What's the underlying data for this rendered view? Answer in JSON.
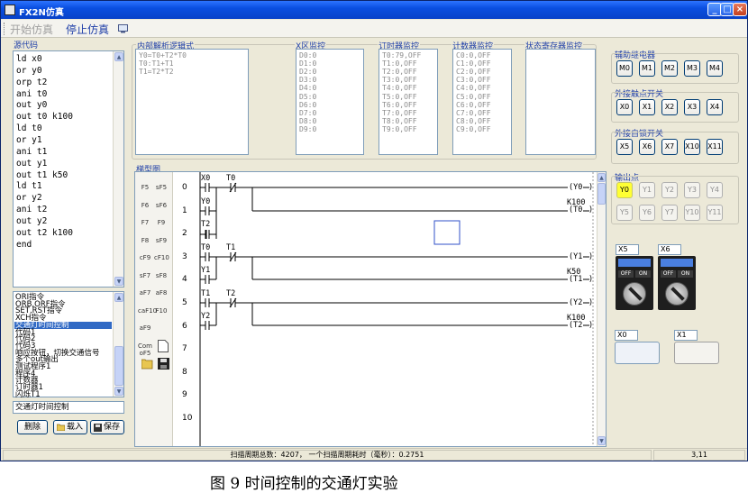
{
  "window": {
    "title": "FX2N仿真",
    "minimize": "_",
    "maximize": "□",
    "close": "×"
  },
  "toolbar": {
    "start_sim": "开始仿真",
    "stop_sim": "停止仿真"
  },
  "source": {
    "label": "源代码",
    "lines": [
      "ld x0",
      "or y0",
      "orp t2",
      "ani t0",
      "out y0",
      "out t0 k100",
      "ld t0",
      "or y1",
      "ani t1",
      "out y1",
      "out t1 k50",
      "ld t1",
      "or y2",
      "ani t2",
      "out y2",
      "out t2 k100",
      "end"
    ]
  },
  "program_list": {
    "items": [
      "ORI指令",
      "ORB,ORF指令",
      "SET,RST指令",
      "XCH指令",
      "交通灯时间控制",
      "代码1",
      "代码2",
      "代码3",
      "响应按钮，切换交通信号",
      "多个out输出",
      "测试程序1",
      "程序4",
      "计数器",
      "订时器1",
      "闪烁T1"
    ],
    "selected_index": 4,
    "selected_name": "交通灯时间控制"
  },
  "buttons": {
    "delete": "删除",
    "load": "载入",
    "save": "保存"
  },
  "logic": {
    "label": "内部解析逻辑式",
    "lines": [
      "Y0=T0+T2*T0",
      "T0:T1+T1",
      "T1=T2*T2"
    ]
  },
  "x_monitor": {
    "label": "X区监控",
    "lines": [
      "D0:0",
      "D1:0",
      "D2:0",
      "D3:0",
      "D4:0",
      "D5:0",
      "D6:0",
      "D7:0",
      "D8:0",
      "D9:0"
    ]
  },
  "timer_monitor": {
    "label": "订时器监控",
    "lines": [
      "T0:79,OFF",
      "T1:0,OFF",
      "T2:0,OFF",
      "T3:0,OFF",
      "T4:0,OFF",
      "T5:0,OFF",
      "T6:0,OFF",
      "T7:0,OFF",
      "T8:0,OFF",
      "T9:0,OFF"
    ]
  },
  "counter_monitor": {
    "label": "计数器监控",
    "lines": [
      "C0:0,OFF",
      "C1:0,OFF",
      "C2:0,OFF",
      "C3:0,OFF",
      "C4:0,OFF",
      "C5:0,OFF",
      "C6:0,OFF",
      "C7:0,OFF",
      "C8:0,OFF",
      "C9:0,OFF"
    ]
  },
  "status_monitor": {
    "label": "状态寄存器监控"
  },
  "ladder": {
    "label": "梯型图",
    "rung_numbers": [
      "0",
      "1",
      "2",
      "3",
      "4",
      "5",
      "6",
      "7",
      "8",
      "9",
      "10"
    ],
    "palette": [
      [
        "F5",
        "sF5"
      ],
      [
        "F6",
        "sF6"
      ],
      [
        "F7",
        "F9"
      ],
      [
        "F8",
        "sF9"
      ],
      [
        "cF9",
        "cF10"
      ],
      [
        "sF7",
        "sF8"
      ],
      [
        "aF7",
        "aF8"
      ],
      [
        "caF10",
        "F10"
      ],
      [
        "aF9",
        ""
      ],
      [
        "Com oF5",
        ""
      ]
    ],
    "contacts": {
      "x0": "X0",
      "t0_nc": "T0",
      "y0": "Y0",
      "t2": "T2",
      "t0": "T0",
      "t1_nc": "T1",
      "y1": "Y1",
      "t1": "T1",
      "t2_nc": "T2",
      "y2": "Y2"
    },
    "coils": {
      "y0": "(Y0",
      "t0": "(T0",
      "t0_k": "K100",
      "y1": "(Y1",
      "t1": "(T1",
      "t1_k": "K50",
      "y2": "(Y2",
      "t2": "(T2",
      "t2_k": "K100"
    },
    "coil_close": ")"
  },
  "aux_relays": {
    "label": "辅助继电器",
    "items": [
      "M0",
      "M1",
      "M2",
      "M3",
      "M4"
    ]
  },
  "ext_contacts": {
    "label": "外接触点开关",
    "items": [
      "X0",
      "X1",
      "X2",
      "X3",
      "X4"
    ]
  },
  "ext_latch": {
    "label": "外接自锁开关",
    "items": [
      "X5",
      "X6",
      "X7",
      "X10",
      "X11"
    ]
  },
  "outputs": {
    "label": "输出点",
    "row1": [
      "Y0",
      "Y1",
      "Y2",
      "Y3",
      "Y4"
    ],
    "row2": [
      "Y5",
      "Y6",
      "Y7",
      "Y10",
      "Y11"
    ],
    "on_index": 0,
    "on_color": "#ffff33"
  },
  "switches": {
    "s1": "X5",
    "s2": "X6",
    "off": "OFF",
    "on": "ON",
    "b1": "X0",
    "b2": "X1"
  },
  "status": {
    "scan": "扫描周期总数：4207， 一个扫描周期耗时（毫秒）：0.2751",
    "pos": "3,11"
  },
  "caption": "图 9  时间控制的交通灯实验"
}
